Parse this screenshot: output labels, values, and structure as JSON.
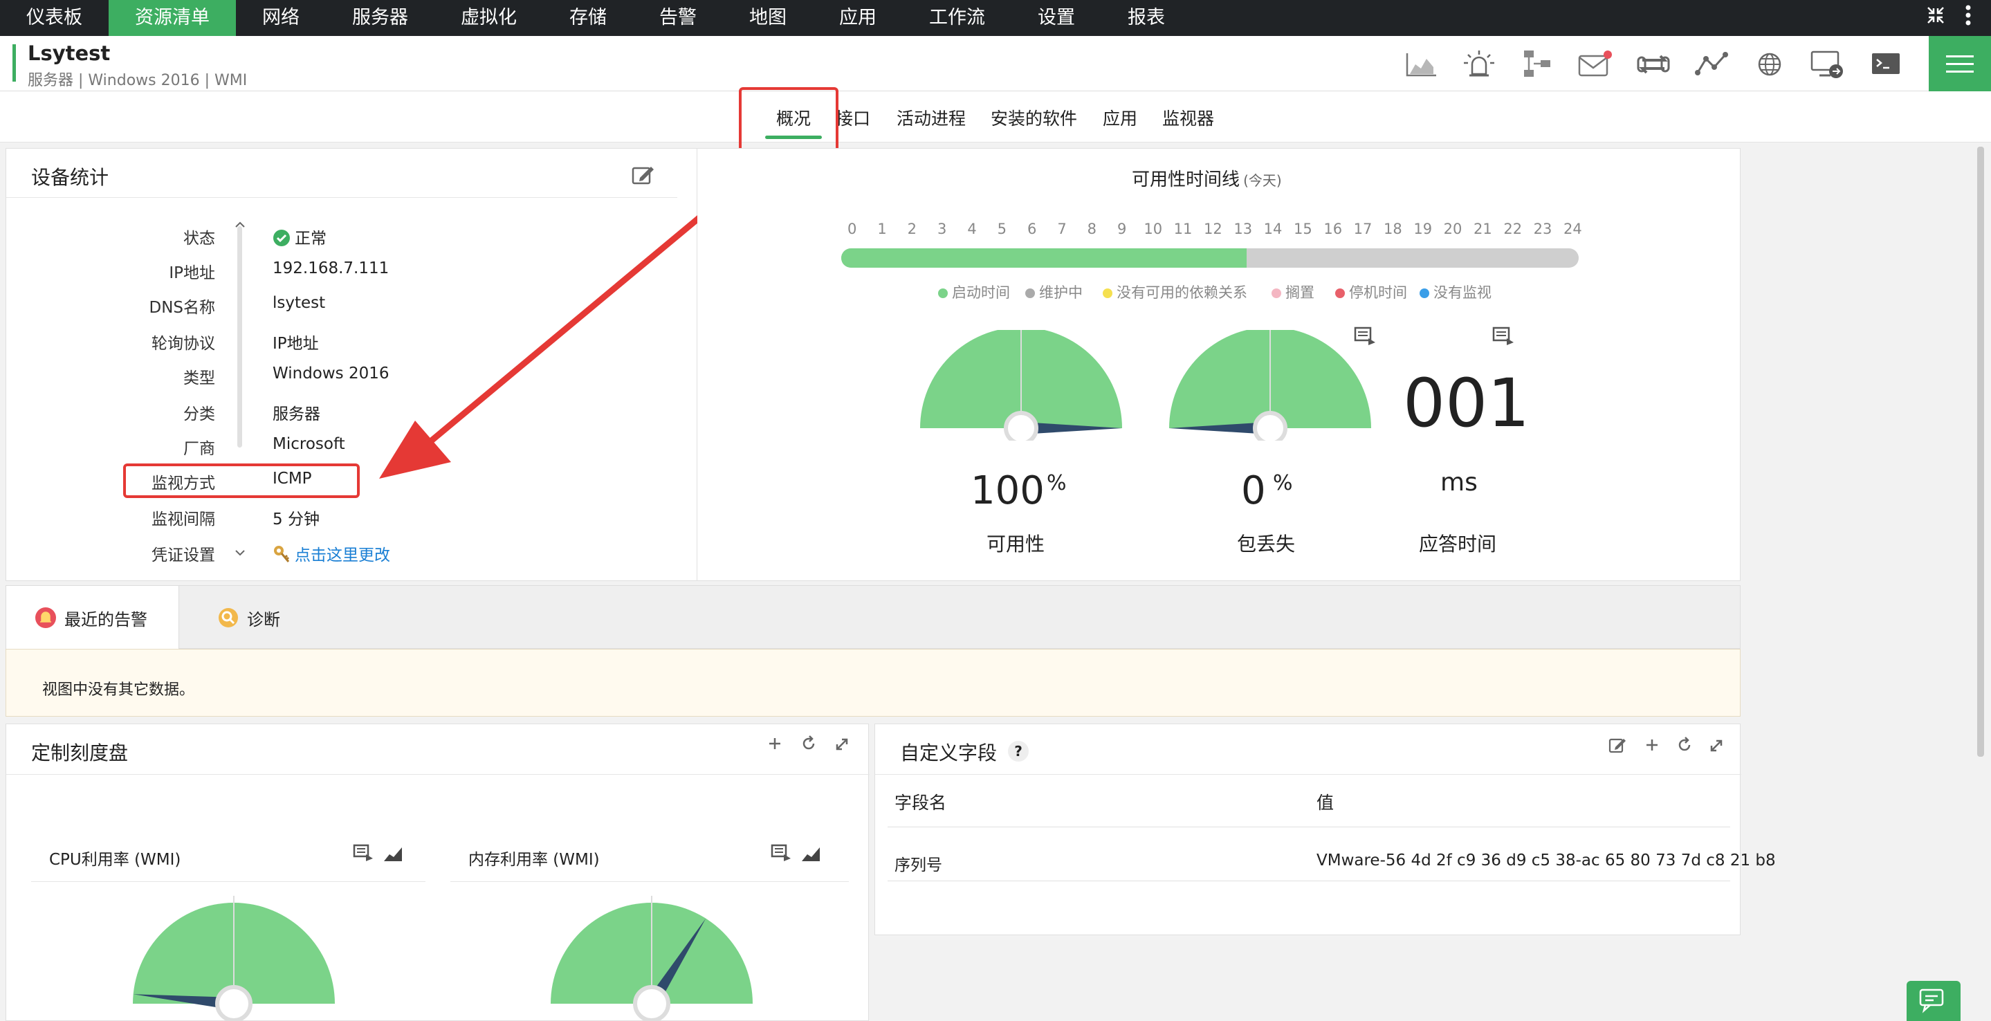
{
  "nav": {
    "items": [
      "仪表板",
      "资源清单",
      "网络",
      "服务器",
      "虚拟化",
      "存储",
      "告警",
      "地图",
      "应用",
      "工作流",
      "设置",
      "报表"
    ],
    "active_index": 1
  },
  "header": {
    "title": "Lsytest",
    "subtitle": "服务器 | Windows 2016 | WMI",
    "tools": [
      "chart-icon",
      "alarm-icon",
      "topology-icon",
      "mail-icon",
      "sync-icon",
      "graph-icon",
      "globe-icon",
      "remote-desktop-icon",
      "terminal-icon"
    ]
  },
  "tabs": [
    "概况",
    "接口",
    "活动进程",
    "安装的软件",
    "应用",
    "监视器"
  ],
  "device_stats": {
    "title": "设备统计",
    "rows": [
      {
        "label": "状态",
        "value": "正常"
      },
      {
        "label": "IP地址",
        "value": "192.168.7.111"
      },
      {
        "label": "DNS名称",
        "value": "lsytest"
      },
      {
        "label": "轮询协议",
        "value": "IP地址"
      },
      {
        "label": "类型",
        "value": "Windows 2016"
      },
      {
        "label": "分类",
        "value": "服务器"
      },
      {
        "label": "厂商",
        "value": "Microsoft"
      },
      {
        "label": "监视方式",
        "value": "ICMP"
      },
      {
        "label": "监视间隔",
        "value": "5 分钟"
      },
      {
        "label": "凭证设置",
        "value": "点击这里更改"
      }
    ]
  },
  "availability": {
    "title": "可用性时间线",
    "subtitle": "(今天)",
    "hours": [
      "0",
      "1",
      "2",
      "3",
      "4",
      "5",
      "6",
      "7",
      "8",
      "9",
      "10",
      "11",
      "12",
      "13",
      "14",
      "15",
      "16",
      "17",
      "18",
      "19",
      "20",
      "21",
      "22",
      "23",
      "24"
    ],
    "uptime_fraction": 0.55,
    "legend": [
      {
        "label": "启动时间",
        "color": "#7bd389"
      },
      {
        "label": "维护中",
        "color": "#aaaaaa"
      },
      {
        "label": "没有可用的依赖关系",
        "color": "#f5e050"
      },
      {
        "label": "搁置",
        "color": "#f4b6c2"
      },
      {
        "label": "停机时间",
        "color": "#e8606a"
      },
      {
        "label": "没有监视",
        "color": "#3a9ee8"
      }
    ],
    "gauges": [
      {
        "value": "100",
        "unit": "%",
        "label": "可用性",
        "level": 100
      },
      {
        "value": "0",
        "unit": "%",
        "label": "包丢失",
        "level": 0
      }
    ],
    "response": {
      "value": "001",
      "unit": "ms",
      "label": "应答时间"
    }
  },
  "alerts": {
    "tabs": [
      "最近的告警",
      "诊断"
    ],
    "empty_text": "视图中没有其它数据。"
  },
  "custom_dials": {
    "title": "定制刻度盘",
    "cards": [
      {
        "title": "CPU利用率 (WMI)",
        "level": 3
      },
      {
        "title": "内存利用率 (WMI)",
        "level": 68
      }
    ]
  },
  "custom_fields": {
    "title": "自定义字段",
    "help": "?",
    "columns": [
      "字段名",
      "值"
    ],
    "rows": [
      {
        "name": "序列号",
        "value": "VMware-56 4d 2f c9 36 d9 c5 38-ac 65 80 73 7d c8 21 b8"
      }
    ]
  },
  "colors": {
    "accent": "#3dae61",
    "gauge": "#7bd389",
    "needle": "#2f4a6b",
    "annotation": "#e53935"
  }
}
